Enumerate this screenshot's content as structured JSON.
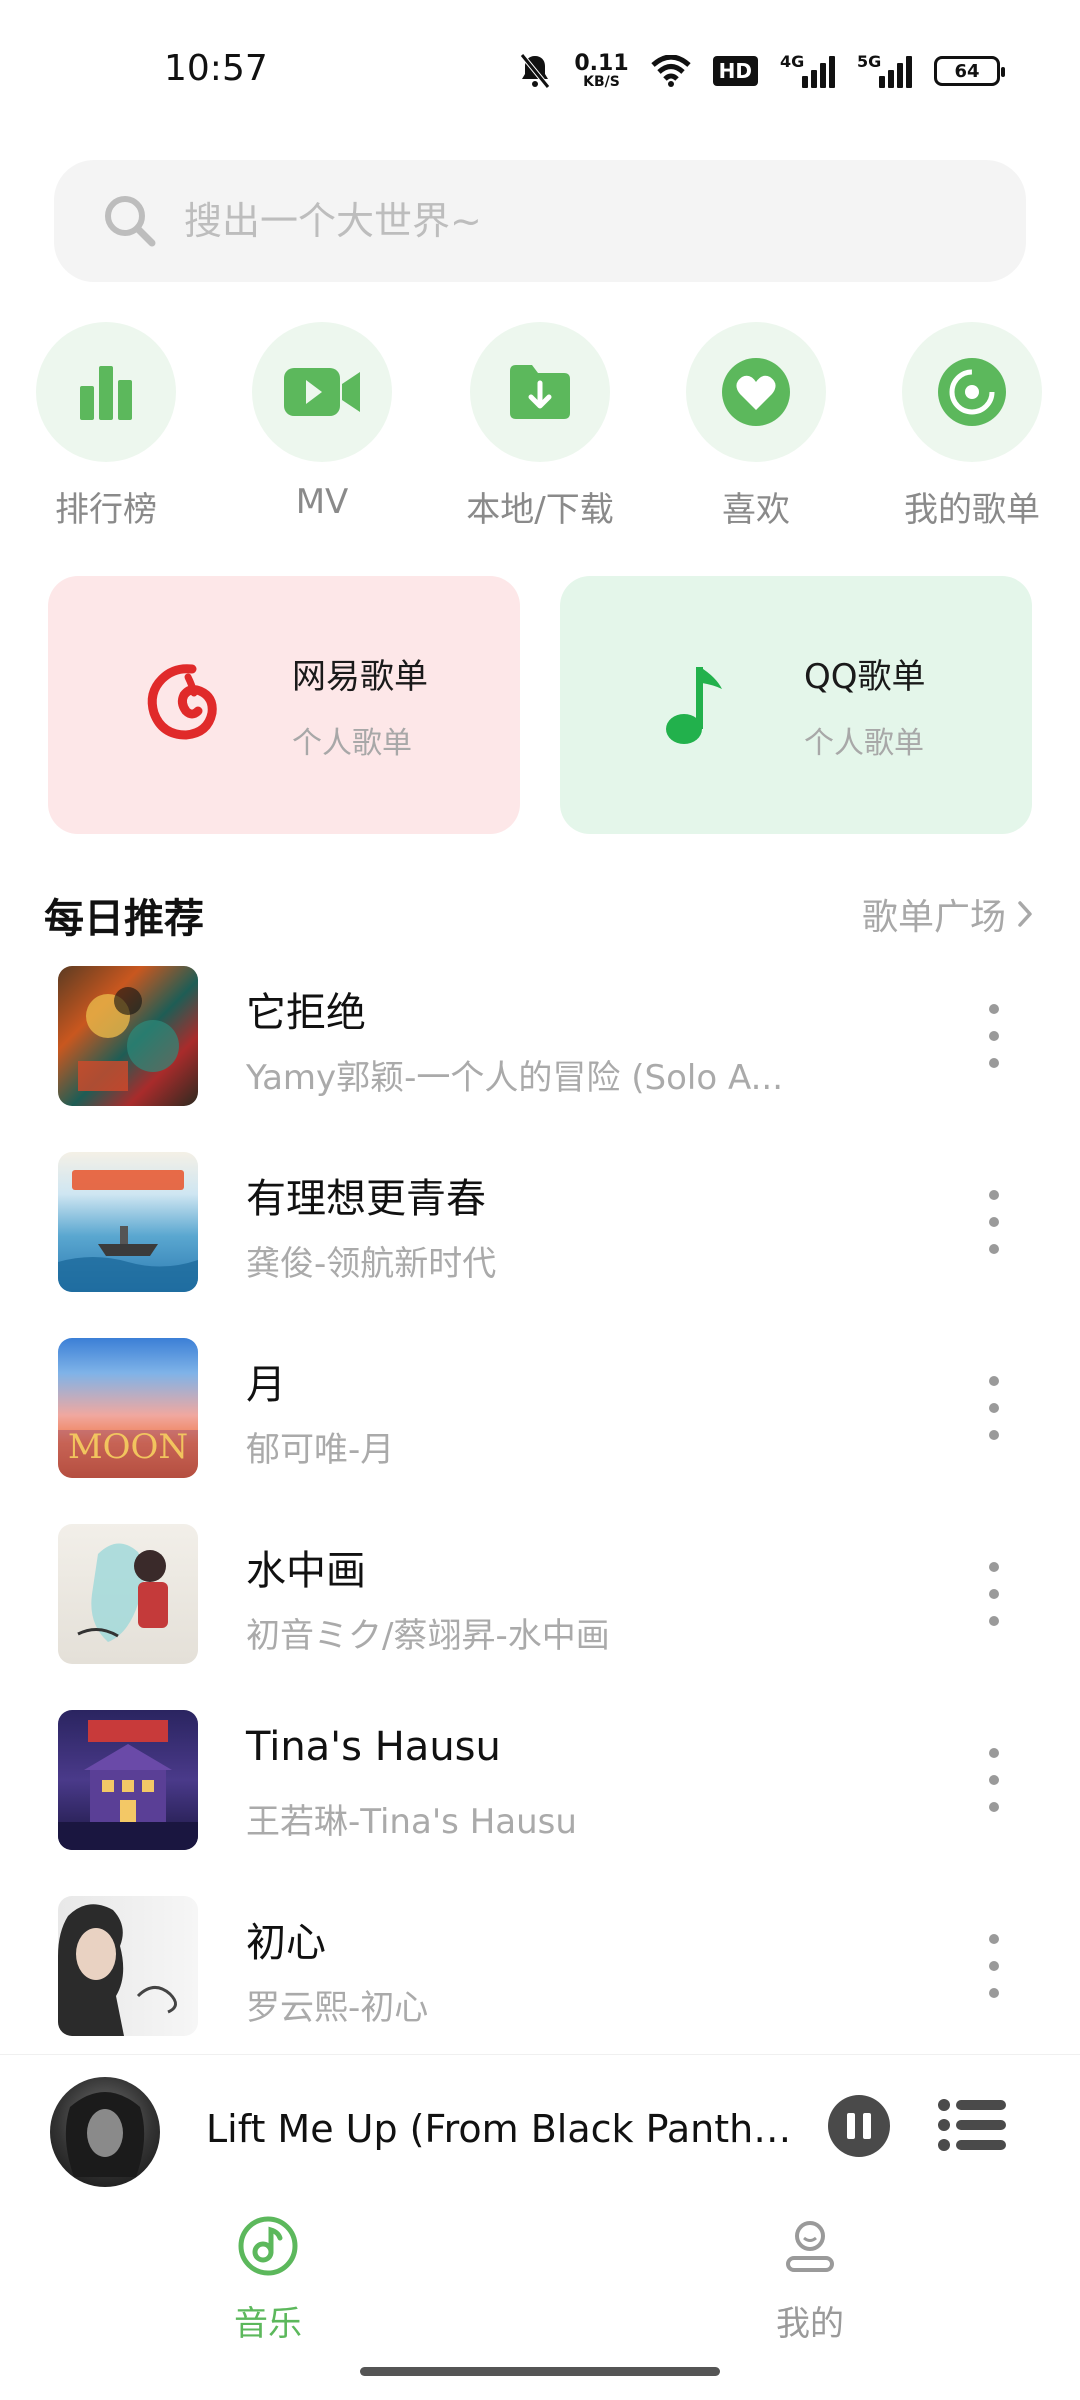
{
  "status_bar": {
    "time": "10:57",
    "net_speed_value": "0.11",
    "net_speed_unit": "KB/S",
    "hd_label": "HD",
    "signal1_label": "4G",
    "signal2_label": "5G",
    "battery": "64",
    "icons": [
      "bell-muted-icon",
      "wifi-icon",
      "signal-icon",
      "battery-icon"
    ]
  },
  "search": {
    "placeholder": "搜出一个大世界~",
    "icon": "search-icon"
  },
  "quick_nav": [
    {
      "label": "排行榜",
      "icon": "bar-chart-icon"
    },
    {
      "label": "MV",
      "icon": "video-camera-icon"
    },
    {
      "label": "本地/下载",
      "icon": "download-folder-icon"
    },
    {
      "label": "喜欢",
      "icon": "heart-icon"
    },
    {
      "label": "我的歌单",
      "icon": "disc-icon"
    }
  ],
  "cards": {
    "netease": {
      "title": "网易歌单",
      "subtitle": "个人歌单",
      "icon": "netease-logo-icon",
      "color": "#e02a2a"
    },
    "qq": {
      "title": "QQ歌单",
      "subtitle": "个人歌单",
      "icon": "qq-music-note-icon",
      "color": "#22b14c"
    }
  },
  "daily": {
    "title": "每日推荐",
    "link": "歌单广场",
    "songs": [
      {
        "title": "它拒绝",
        "subtitle": "Yamy郭颖-一个人的冒险 (Solo A..."
      },
      {
        "title": "有理想更青春",
        "subtitle": "龚俊-领航新时代"
      },
      {
        "title": "月",
        "subtitle": "郁可唯-月"
      },
      {
        "title": "水中画",
        "subtitle": "初音ミク/蔡翊昇-水中画"
      },
      {
        "title": "Tina's Hausu",
        "subtitle": "王若琳-Tina's Hausu"
      },
      {
        "title": "初心",
        "subtitle": "罗云熙-初心"
      }
    ]
  },
  "player": {
    "title": "Lift Me Up (From Black Panther: ..."
  },
  "bottom_nav": {
    "music": "音乐",
    "mine": "我的",
    "active_color": "#5cb85c",
    "inactive_color": "#9a9a9a"
  }
}
